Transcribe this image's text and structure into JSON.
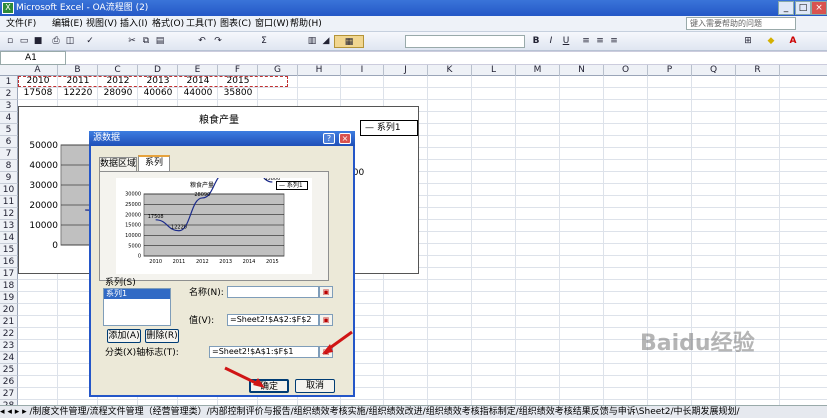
{
  "window": {
    "title": "Microsoft Excel - OA流程图 (2)",
    "min": "_",
    "max": "□",
    "close": "×"
  },
  "menu": {
    "items": [
      "文件(F)",
      "编辑(E)",
      "视图(V)",
      "插入(I)",
      "格式(O)",
      "工具(T)",
      "图表(C)",
      "窗口(W)",
      "帮助(H)"
    ],
    "help_placeholder": "键入需要帮助的问题"
  },
  "toolbar": {
    "sum": "Σ",
    "zoom": "宋体",
    "bold": "B",
    "italic": "I",
    "underline": "U"
  },
  "namebox": "A1",
  "columns": [
    "A",
    "B",
    "C",
    "D",
    "E",
    "F",
    "G",
    "H",
    "I",
    "J",
    "K",
    "L",
    "M",
    "N",
    "O",
    "P",
    "Q",
    "R"
  ],
  "rows": [
    "1",
    "2",
    "3",
    "4",
    "5",
    "6",
    "7",
    "8",
    "9",
    "10",
    "11",
    "12",
    "13",
    "14",
    "15",
    "16",
    "17",
    "18",
    "19",
    "20",
    "21",
    "22",
    "23",
    "24",
    "25",
    "26",
    "27",
    "28"
  ],
  "row1": [
    "2010",
    "2011",
    "2012",
    "2013",
    "2014",
    "2015"
  ],
  "row2": [
    "17508",
    "12220",
    "28090",
    "40060",
    "44000",
    "35800"
  ],
  "chart_data": {
    "type": "line",
    "title": "粮食产量",
    "categories": [
      "2010",
      "2011",
      "2012",
      "2013",
      "2014",
      "2015"
    ],
    "series": [
      {
        "name": "系列1",
        "values": [
          17508,
          12220,
          28090,
          40060,
          44000,
          35800
        ]
      }
    ],
    "ylim": [
      0,
      50000
    ],
    "yticks": [
      "50000",
      "40000",
      "30000",
      "20000",
      "10000",
      "0"
    ],
    "preview_yticks": [
      "30000",
      "25000",
      "20000",
      "15000",
      "10000",
      "5000",
      "0"
    ],
    "partial_label": "800",
    "legend": "right",
    "grid": true
  },
  "dialog": {
    "title": "源数据",
    "help": "?",
    "close": "×",
    "tabs": [
      "数据区域",
      "系列"
    ],
    "series_label": "系列(S)",
    "series_list": [
      "系列1"
    ],
    "name_label": "名称(N):",
    "name_value": "",
    "value_label": "值(V):",
    "value_ref": "=Sheet2!$A$2:$F$2",
    "category_label": "分类(X)轴标志(T):",
    "category_ref": "=Sheet2!$A$1:$F$1",
    "add": "添加(A)",
    "delete": "删除(R)",
    "ok": "确定",
    "cancel": "取消"
  },
  "sheettabs": "◂ ◂ ▸ ▸ /制度文件管理/流程文件管理（经营管理类）/内部控制评价与报告/组织绩效考核实施/组织绩效改进/组织绩效考核指标制定/组织绩效考核结果反馈与申诉\\Sheet2/中长期发展规划/",
  "watermark": "Baidu经验"
}
